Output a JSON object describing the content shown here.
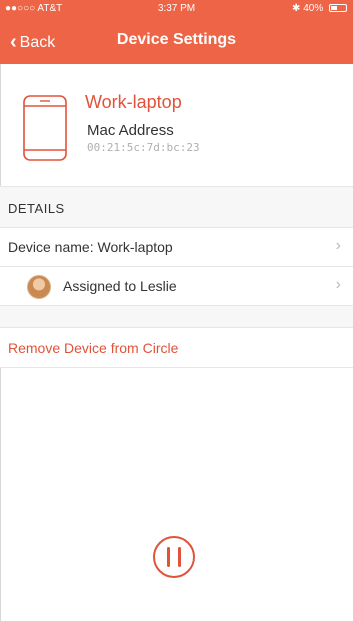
{
  "status_bar": {
    "carrier": "●●○○○ AT&T",
    "time": "3:37 PM",
    "bluetooth": "✱",
    "battery": "40%"
  },
  "nav": {
    "back_label": "Back",
    "title": "Device Settings"
  },
  "device": {
    "name": "Work-laptop",
    "mac_label": "Mac Address",
    "mac_value": "00:21:5c:7d:bc:23",
    "icon": "phone-outline-icon"
  },
  "details": {
    "header": "DETAILS",
    "rows": [
      {
        "label": "Device name: Work-laptop"
      },
      {
        "label": "Assigned to Leslie"
      }
    ]
  },
  "actions": {
    "remove_label": "Remove Device from Circle"
  },
  "colors": {
    "accent": "#ee6446",
    "accent_text": "#e0533a",
    "section_bg": "#f7f7f7"
  }
}
